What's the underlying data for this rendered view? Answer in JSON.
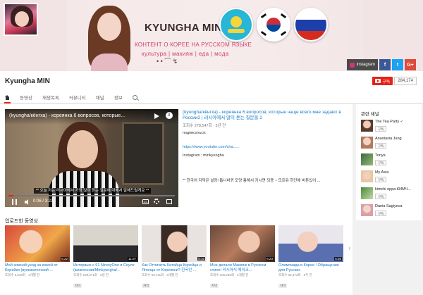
{
  "banner": {
    "brand_title": "KYUNGHA MIN",
    "subtitle_line1": "КОНТЕНТ О КОРЕЕ НА РУССКОМ ЯЗЫКЕ",
    "subtitle_line2": "культура | макияж | еда | мода",
    "links": [
      {
        "label": "instagram",
        "icon": "instagram-icon"
      },
      {
        "label": "f",
        "icon": "facebook-icon",
        "color": "#3b5998"
      },
      {
        "label": "t",
        "icon": "twitter-icon",
        "color": "#1da1f2"
      },
      {
        "label": "G+",
        "icon": "google-plus-icon",
        "color": "#dd4b39"
      }
    ]
  },
  "channel": {
    "name": "Kyungha MIN",
    "subscribe_label": "구독",
    "subscriber_count": "284,174",
    "tabs": [
      {
        "label": "",
        "icon": "home-icon",
        "active": true
      },
      {
        "label": "동영상"
      },
      {
        "label": "재생목록"
      },
      {
        "label": "커뮤니티"
      },
      {
        "label": "채널"
      },
      {
        "label": "정보"
      },
      {
        "label": "",
        "icon": "search-icon"
      }
    ]
  },
  "featured": {
    "player_title": "(kyungha/кёнгха) - кореянка 6 вопросов, которые...",
    "subtitle_text": "** 오늘 저는 러시아에서 가장 많이 듣는 질문에 대해서 말해드릴게요 **",
    "time": "0:06 / 3:23",
    "progress": 0.03,
    "title": "(kyungha/кёнгха) - кореянка 6 вопросов, которые чаще всего мне задают в России2 | 러시아에서 많이 듣는 질문들 2",
    "meta": "조회수 278,547회 · 3년 전",
    "desc1": "подписаться:",
    "link": "https://www.youtube.com/cha......",
    "desc2": "Instagram : minkyungha",
    "desc3": "** 한국어 자막은 설정! 톱니바퀴 모양 통해서 키시면 되용 ~ 모르뮤 하단에 버튼있어 ..."
  },
  "uploads": {
    "heading": "업로드한 동영상",
    "items": [
      {
        "title": "Мой зимний уход за кожей от Корейки (вулканический ...",
        "meta": "조회수 9,549회 · 1개월 전",
        "duration": "6:22",
        "badge": ""
      },
      {
        "title": "Интервью с 91 NinetyOne в Сеуле (жизненная/Minkyungha/...",
        "meta": "조회수 109,271회 · 6일 전",
        "duration": "11:07",
        "badge": "자막"
      },
      {
        "title": "Как Отличить Китайца Корейца и Японца от Кореянки? 한국인 ...",
        "meta": "조회수 93,711회 · 3개월 전",
        "duration": "6:10",
        "badge": "자막"
      },
      {
        "title": "Мне делали Макияж в Русском стиле! 러시아식 메이크...",
        "meta": "조회수 106,235회 · 2개월 전",
        "duration": "6:23",
        "badge": "자막"
      },
      {
        "title": "Олимпиада в Корее ! Обращение для Русских",
        "meta": "조회수 32,373회 · 3주 전",
        "duration": "6:36",
        "badge": "자막"
      }
    ]
  },
  "related": {
    "heading": "관련 채널",
    "subscribe_label": "구독",
    "channels": [
      {
        "name": "The Tea Party",
        "verified": true
      },
      {
        "name": "Anastasia Jung"
      },
      {
        "name": "Tonya"
      },
      {
        "name": "My Asia"
      },
      {
        "name": "kimchi oppa КИМЧ..."
      },
      {
        "name": "Dania Sagiyeva"
      }
    ]
  }
}
